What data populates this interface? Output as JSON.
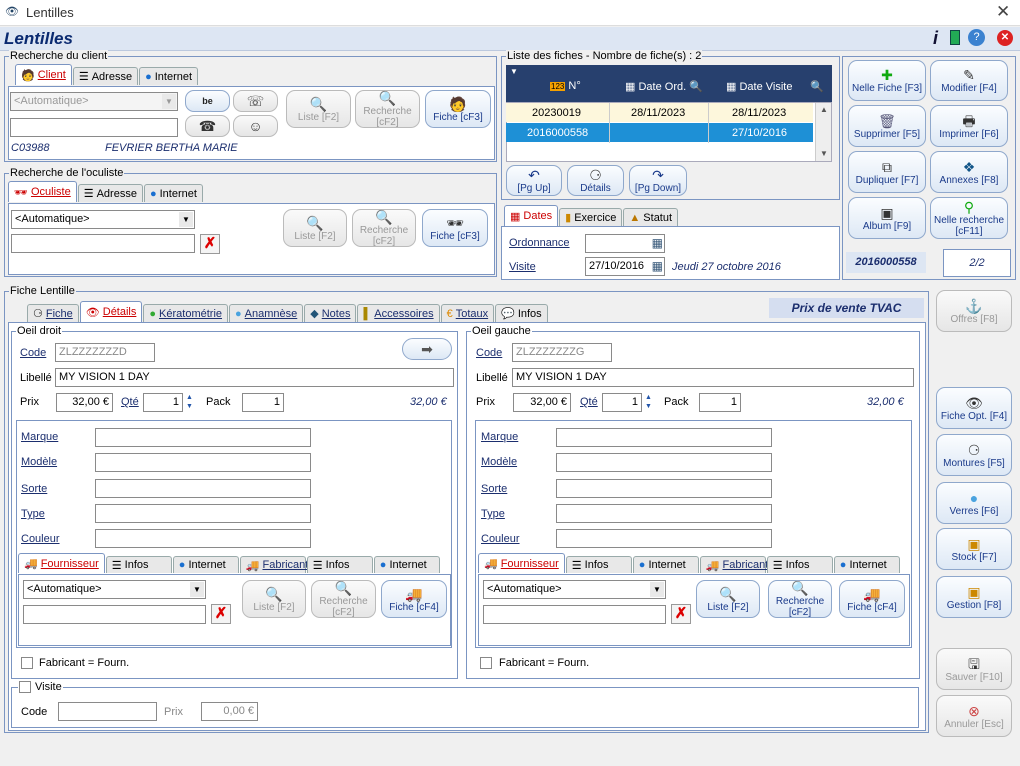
{
  "window": {
    "title": "Lentilles",
    "close": "✕"
  },
  "app": {
    "title": "Lentilles"
  },
  "client_group": {
    "legend": "Recherche du client",
    "tabs": [
      "Client",
      "Adresse",
      "Internet"
    ],
    "combo": "<Automatique>",
    "client_code": "C03988",
    "client_name": "FEVRIER BERTHA MARIE",
    "btn_liste": "Liste [F2]",
    "btn_recherche": "Recherche [cF2]",
    "btn_fiche": "Fiche [cF3]"
  },
  "oculiste_group": {
    "legend": "Recherche de l'oculiste",
    "tabs": [
      "Oculiste",
      "Adresse",
      "Internet"
    ],
    "combo": "<Automatique>",
    "btn_liste": "Liste [F2]",
    "btn_recherche": "Recherche [cF2]",
    "btn_fiche": "Fiche [cF3]"
  },
  "fiches": {
    "legend": "Liste des fiches - Nombre de fiche(s) : 2",
    "columns": [
      "N°",
      "Date Ord.",
      "Date Visite"
    ],
    "rows": [
      [
        "20230019",
        "28/11/2023",
        "28/11/2023"
      ],
      [
        "2016000558",
        "",
        "27/10/2016"
      ]
    ],
    "btn_pgup": "[Pg Up]",
    "btn_details": "Détails",
    "btn_pgdown": "[Pg Down]"
  },
  "dates": {
    "tabs": [
      "Dates",
      "Exercice",
      "Statut"
    ],
    "ordonnance_label": "Ordonnance",
    "ordonnance_value": "",
    "visite_label": "Visite",
    "visite_value": "27/10/2016",
    "visite_text": "Jeudi 27 octobre 2016"
  },
  "actions": {
    "nouvelle_fiche": "Nelle Fiche [F3]",
    "modifier": "Modifier [F4]",
    "supprimer": "Supprimer [F5]",
    "imprimer": "Imprimer [F6]",
    "dupliquer": "Dupliquer [F7]",
    "annexes": "Annexes [F8]",
    "album": "Album [F9]",
    "nouvelle_recherche": "Nelle recherche [cF11]",
    "record_id": "2016000558",
    "record_pos": "2/2"
  },
  "fiche": {
    "legend": "Fiche Lentille",
    "tabs": [
      "Fiche",
      "Détails",
      "Kératométrie",
      "Anamnèse",
      "Notes",
      "Accessoires",
      "Totaux",
      "Infos"
    ],
    "prix_label": "Prix de vente TVAC"
  },
  "oeil_droit": {
    "legend": "Oeil droit",
    "code_label": "Code",
    "code": "ZLZZZZZZZD",
    "libelle_label": "Libellé",
    "libelle": "MY VISION 1 DAY",
    "prix_label": "Prix",
    "prix": "32,00 €",
    "qte_label": "Qté",
    "qte": "1",
    "pack_label": "Pack",
    "pack": "1",
    "total": "32,00 €",
    "marque": "Marque",
    "modele": "Modèle",
    "sorte": "Sorte",
    "type": "Type",
    "couleur": "Couleur",
    "sub_tabs": [
      "Fournisseur",
      "Infos",
      "Internet",
      "Fabricant",
      "Infos",
      "Internet"
    ],
    "combo": "<Automatique>",
    "btn_liste": "Liste [F2]",
    "btn_recherche": "Recherche [cF2]",
    "btn_fiche": "Fiche [cF4]",
    "fab_check": "Fabricant = Fourn."
  },
  "oeil_gauche": {
    "legend": "Oeil gauche",
    "code_label": "Code",
    "code": "ZLZZZZZZZG",
    "libelle_label": "Libellé",
    "libelle": "MY VISION 1 DAY",
    "prix_label": "Prix",
    "prix": "32,00 €",
    "qte_label": "Qté",
    "qte": "1",
    "pack_label": "Pack",
    "pack": "1",
    "total": "32,00 €",
    "marque": "Marque",
    "modele": "Modèle",
    "sorte": "Sorte",
    "type": "Type",
    "couleur": "Couleur",
    "sub_tabs": [
      "Fournisseur",
      "Infos",
      "Internet",
      "Fabricant",
      "Infos",
      "Internet"
    ],
    "combo": "<Automatique>",
    "btn_liste": "Liste [F2]",
    "btn_recherche": "Recherche [cF2]",
    "btn_fiche": "Fiche [cF4]",
    "fab_check": "Fabricant = Fourn."
  },
  "visite_group": {
    "legend": "Visite",
    "code_label": "Code",
    "prix_label": "Prix",
    "prix": "0,00 €"
  },
  "right_bar": {
    "offres": "Offres [F8]",
    "fiche_opt": "Fiche Opt. [F4]",
    "montures": "Montures [F5]",
    "verres": "Verres [F6]",
    "stock": "Stock [F7]",
    "gestion": "Gestion [F8]",
    "sauver": "Sauver [F10]",
    "annuler": "Annuler [Esc]"
  }
}
